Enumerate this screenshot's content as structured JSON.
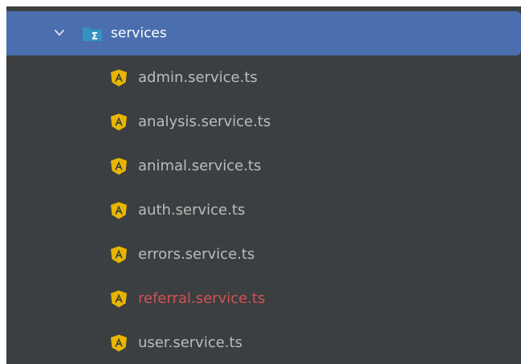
{
  "colors": {
    "panel_bg": "#3c3f41",
    "selection_bg": "#4b6eaf",
    "file_text": "#bbbbbb",
    "modified_text": "#d25252",
    "angular_icon": "#e8b600",
    "folder_icon": "#3592c4"
  },
  "folder": {
    "label": "services",
    "expanded": true,
    "icon": "folder-sigma-icon"
  },
  "files": [
    {
      "label": "admin.service.ts",
      "icon": "angular-icon",
      "status": "normal"
    },
    {
      "label": "analysis.service.ts",
      "icon": "angular-icon",
      "status": "normal"
    },
    {
      "label": "animal.service.ts",
      "icon": "angular-icon",
      "status": "normal"
    },
    {
      "label": "auth.service.ts",
      "icon": "angular-icon",
      "status": "normal"
    },
    {
      "label": "errors.service.ts",
      "icon": "angular-icon",
      "status": "normal"
    },
    {
      "label": "referral.service.ts",
      "icon": "angular-icon",
      "status": "modified"
    },
    {
      "label": "user.service.ts",
      "icon": "angular-icon",
      "status": "normal"
    }
  ]
}
